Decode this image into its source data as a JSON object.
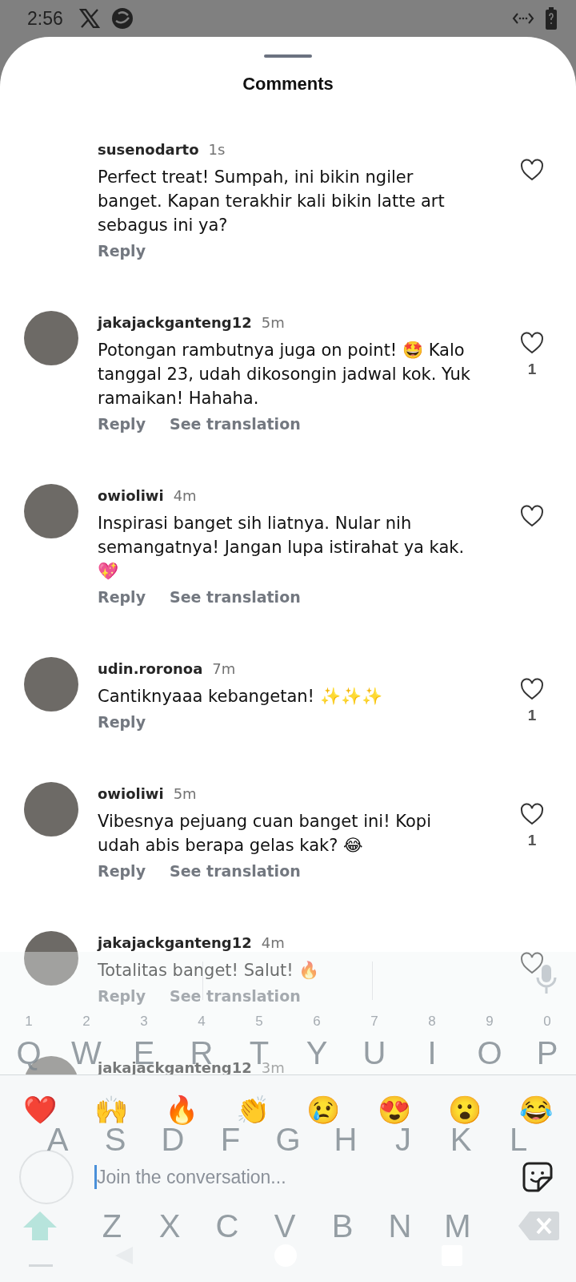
{
  "status_bar": {
    "time": "2:56"
  },
  "sheet": {
    "title": "Comments"
  },
  "comments": [
    {
      "username": "susenodarto",
      "time": "1s",
      "avatar": false,
      "text": "Perfect treat! Sumpah, ini bikin ngiler banget. Kapan terakhir kali bikin latte art sebagus ini ya?",
      "actions": [
        "Reply"
      ],
      "liked": false
    },
    {
      "username": "jakajackganteng12",
      "time": "5m",
      "avatar": true,
      "text": "Potongan rambutnya juga on point! 🤩 Kalo tanggal 23, udah dikosongin jadwal kok. Yuk ramaikan! Hahaha.",
      "actions": [
        "Reply",
        "See translation"
      ],
      "liked": false,
      "likes": "1"
    },
    {
      "username": "owioliwi",
      "time": "4m",
      "avatar": true,
      "text": "Inspirasi banget sih liatnya. Nular nih semangatnya! Jangan lupa istirahat ya kak. 💖",
      "actions": [
        "Reply",
        "See translation"
      ],
      "liked": false
    },
    {
      "username": "udin.roronoa",
      "time": "7m",
      "avatar": true,
      "text": "Cantiknyaaa kebangetan! ✨✨✨",
      "actions": [
        "Reply"
      ],
      "liked": false,
      "likes": "1"
    },
    {
      "username": "owioliwi",
      "time": "5m",
      "avatar": true,
      "text": "Vibesnya pejuang cuan banget ini! Kopi udah abis berapa gelas kak? 😂",
      "actions": [
        "Reply",
        "See translation"
      ],
      "liked": false,
      "likes": "1"
    },
    {
      "username": "jakajackganteng12",
      "time": "4m",
      "avatar": true,
      "text": "Totalitas banget! Salut! 🔥",
      "actions": [
        "Reply",
        "See translation"
      ],
      "liked": false
    },
    {
      "username": "jakajackganteng12",
      "time": "3m",
      "avatar": true
    }
  ],
  "keyboard": {
    "rows": [
      [
        {
          "key": "Q",
          "hint": "1"
        },
        {
          "key": "W",
          "hint": "2"
        },
        {
          "key": "E",
          "hint": "3"
        },
        {
          "key": "R",
          "hint": "4"
        },
        {
          "key": "T",
          "hint": "5"
        },
        {
          "key": "Y",
          "hint": "6"
        },
        {
          "key": "U",
          "hint": "7"
        },
        {
          "key": "I",
          "hint": "8"
        },
        {
          "key": "O",
          "hint": "9"
        },
        {
          "key": "P",
          "hint": "0"
        }
      ],
      [
        {
          "key": "A"
        },
        {
          "key": "S"
        },
        {
          "key": "D"
        },
        {
          "key": "F"
        },
        {
          "key": "G"
        },
        {
          "key": "H"
        },
        {
          "key": "J"
        },
        {
          "key": "K"
        },
        {
          "key": "L"
        }
      ],
      [
        {
          "key": "Z"
        },
        {
          "key": "X"
        },
        {
          "key": "C"
        },
        {
          "key": "V"
        },
        {
          "key": "B"
        },
        {
          "key": "N"
        },
        {
          "key": "M"
        }
      ]
    ]
  },
  "composer": {
    "reactions": [
      "❤️",
      "🙌",
      "🔥",
      "👏",
      "😢",
      "😍",
      "😮",
      "😂"
    ],
    "placeholder": "Join the conversation..."
  }
}
